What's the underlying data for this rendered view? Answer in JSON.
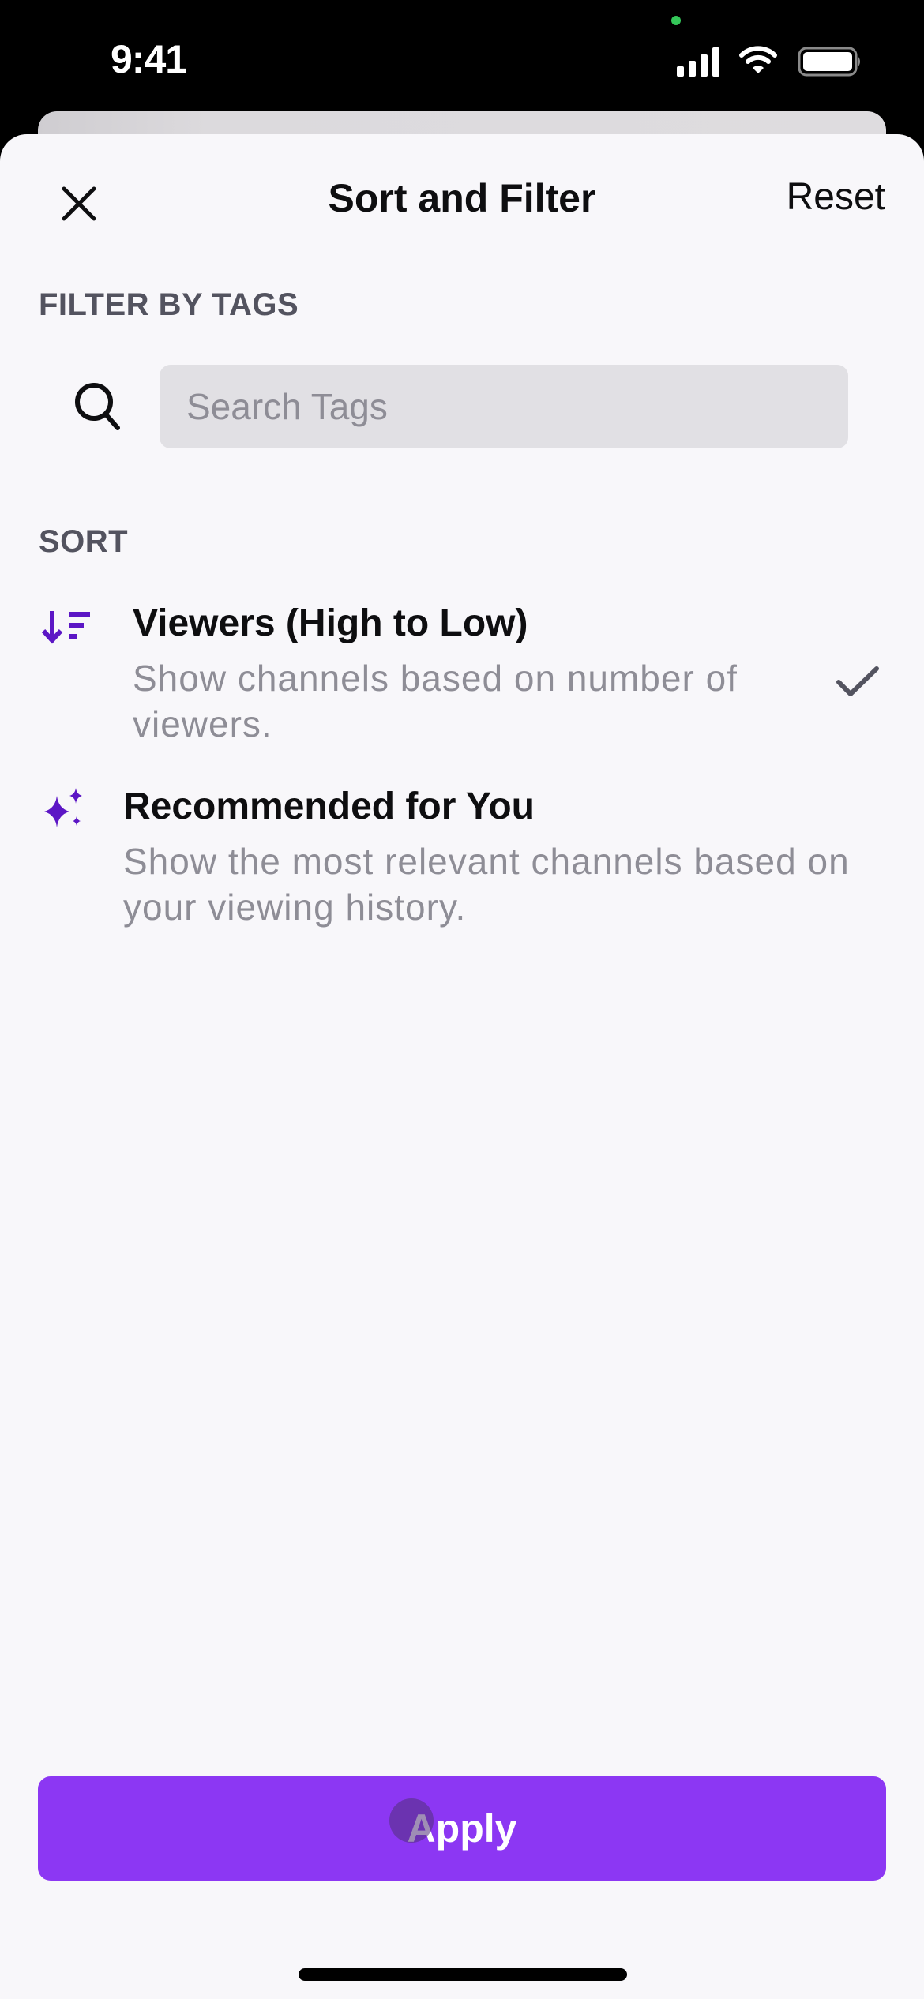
{
  "status_bar": {
    "time": "9:41",
    "icons": [
      "signal-icon",
      "wifi-icon",
      "battery-icon"
    ]
  },
  "header": {
    "title": "Sort and Filter",
    "close_icon": "close-icon",
    "reset_label": "Reset"
  },
  "filter": {
    "section_label": "FILTER BY TAGS",
    "search_icon": "search-icon",
    "search_placeholder": "Search Tags",
    "search_value": ""
  },
  "sort": {
    "section_label": "SORT",
    "options": [
      {
        "icon": "sort-descending-icon",
        "title": "Viewers (High to Low)",
        "description": "Show channels based on number of viewers.",
        "selected": true
      },
      {
        "icon": "sparkles-icon",
        "title": "Recommended for You",
        "description": "Show the most relevant channels based on your viewing history.",
        "selected": false
      }
    ]
  },
  "footer": {
    "apply_label": "Apply"
  },
  "colors": {
    "accent": "#8c37f3",
    "icon_purple": "#5c16c5",
    "sheet_background": "#f8f7fa",
    "search_background": "#e1e0e4",
    "secondary_text": "#8e8d96"
  }
}
